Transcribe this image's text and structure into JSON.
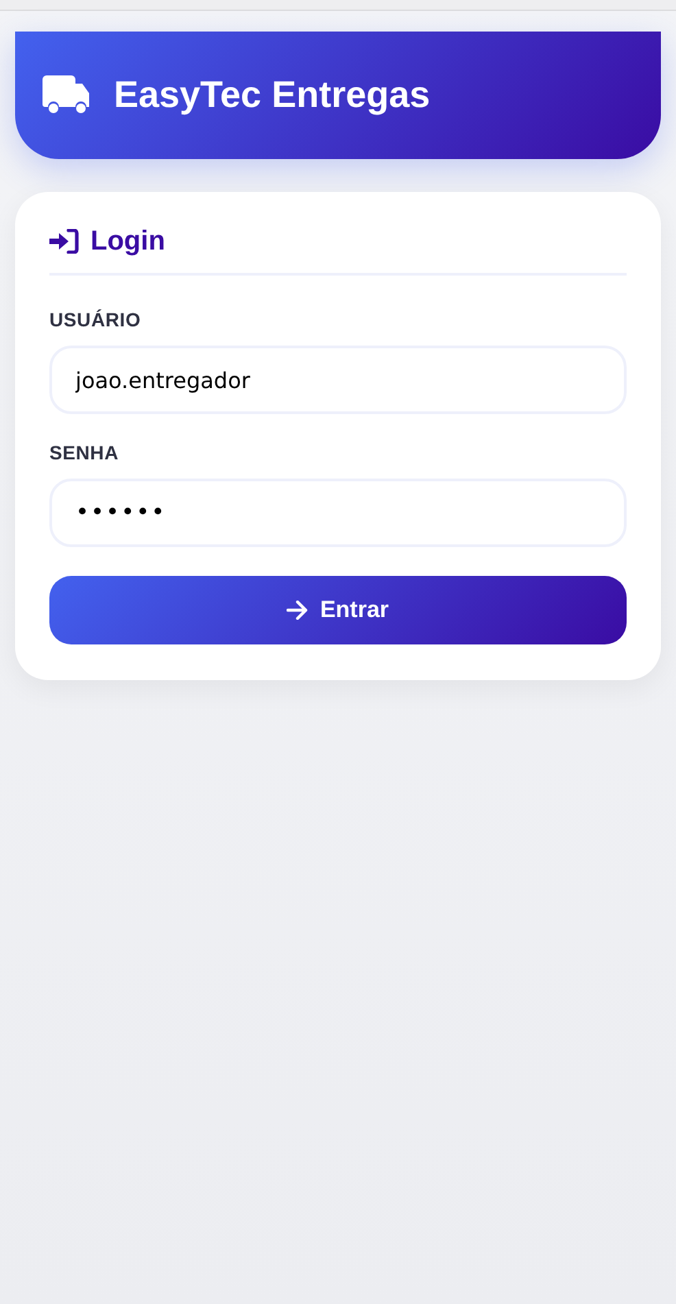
{
  "header": {
    "title": "EasyTec Entregas"
  },
  "login": {
    "title": "Login",
    "fields": [
      {
        "label": "USUÁRIO",
        "value": "joao.entregador",
        "kind": "text"
      },
      {
        "label": "SENHA",
        "value": "••••••",
        "kind": "password"
      }
    ],
    "button": "Entrar"
  }
}
